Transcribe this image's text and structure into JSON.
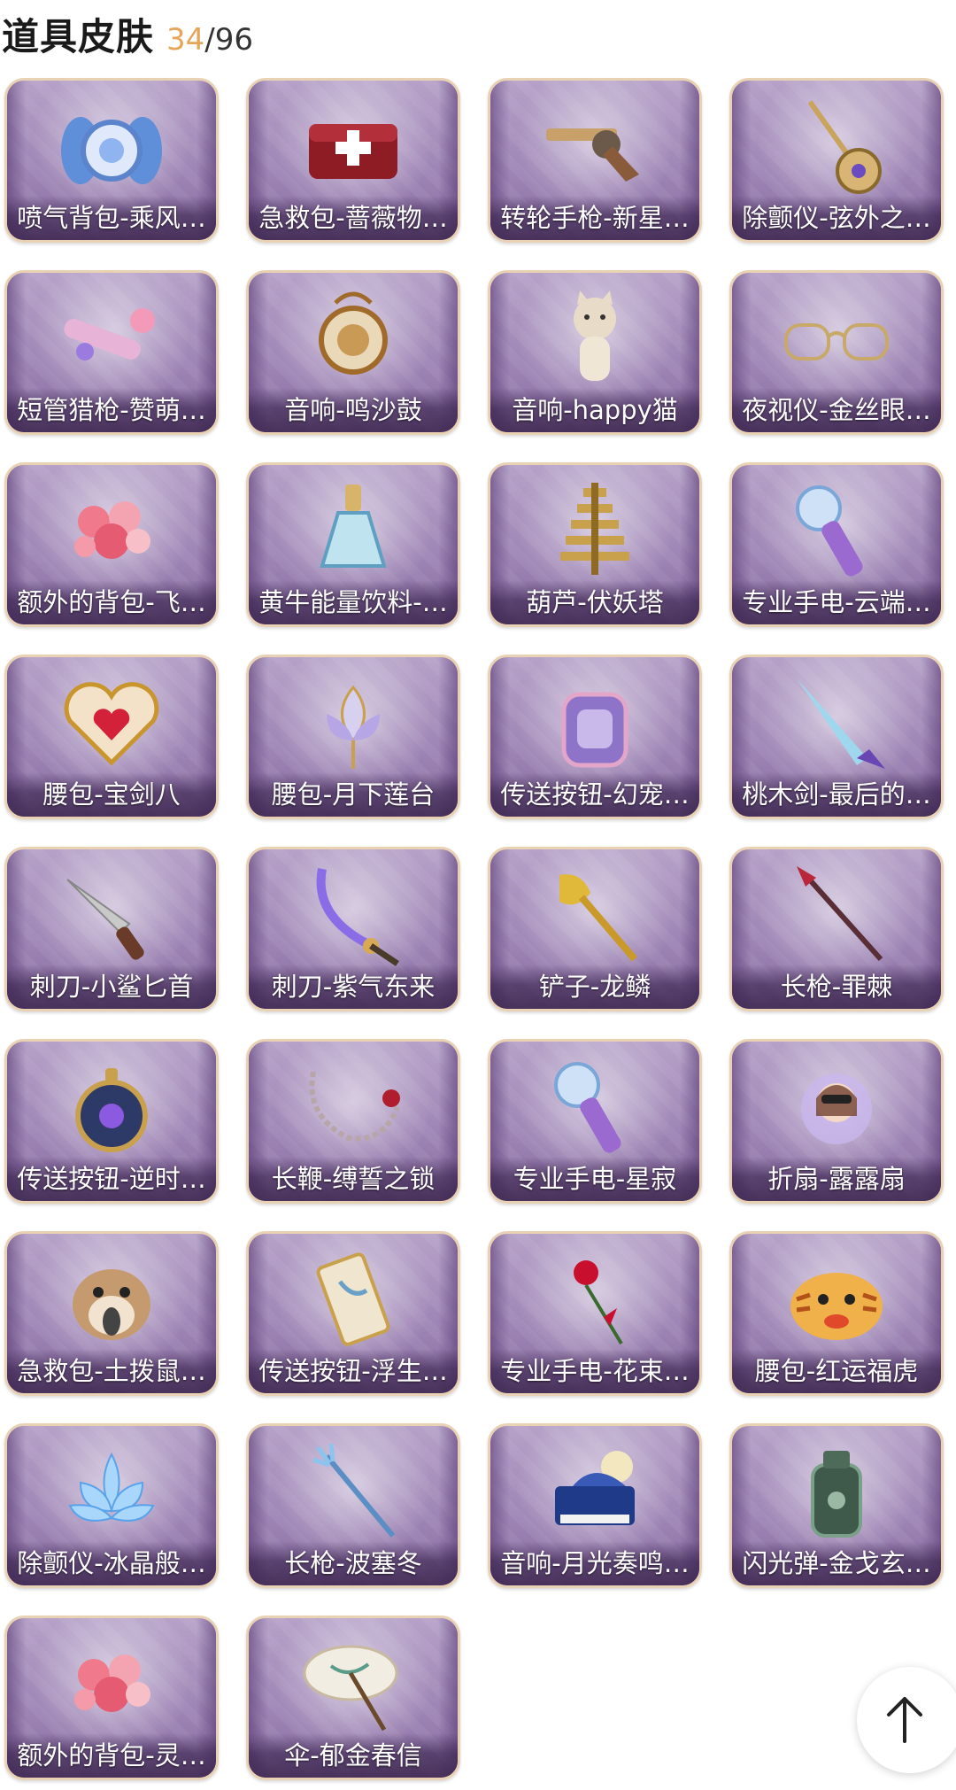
{
  "header": {
    "title": "道具皮肤",
    "owned": "34",
    "separator": "/",
    "total": "96"
  },
  "items": [
    {
      "label": "喷气背包-乘风…",
      "icon": "jetpack-icon"
    },
    {
      "label": "急救包-蔷薇物…",
      "icon": "first-aid-kit-icon"
    },
    {
      "label": "转轮手枪-新星…",
      "icon": "revolver-icon"
    },
    {
      "label": "除颤仪-弦外之…",
      "icon": "lute-icon"
    },
    {
      "label": "短管猎枪-赞萌…",
      "icon": "toy-shotgun-icon"
    },
    {
      "label": "音响-鸣沙鼓",
      "icon": "drum-icon"
    },
    {
      "label": "音响-happy猫",
      "icon": "cat-figure-icon"
    },
    {
      "label": "夜视仪-金丝眼…",
      "icon": "glasses-icon"
    },
    {
      "label": "额外的背包-飞…",
      "icon": "flower-bouquet-icon"
    },
    {
      "label": "黄牛能量饮料-…",
      "icon": "bottle-icon"
    },
    {
      "label": "葫芦-伏妖塔",
      "icon": "pagoda-icon"
    },
    {
      "label": "专业手电-云端…",
      "icon": "flashlight-icon"
    },
    {
      "label": "腰包-宝剑八",
      "icon": "heart-pouch-icon"
    },
    {
      "label": "腰包-月下莲台",
      "icon": "lotus-pouch-icon"
    },
    {
      "label": "传送按钮-幻宠…",
      "icon": "device-icon"
    },
    {
      "label": "桃木剑-最后的…",
      "icon": "horn-sword-icon"
    },
    {
      "label": "刺刀-小鲨匕首",
      "icon": "shark-dagger-icon"
    },
    {
      "label": "刺刀-紫气东来",
      "icon": "curved-blade-icon"
    },
    {
      "label": "铲子-龙鳞",
      "icon": "shovel-icon"
    },
    {
      "label": "长枪-罪棘",
      "icon": "spear-icon"
    },
    {
      "label": "传送按钮-逆时…",
      "icon": "pocket-watch-icon"
    },
    {
      "label": "长鞭-缚誓之锁",
      "icon": "chain-whip-icon"
    },
    {
      "label": "专业手电-星寂",
      "icon": "flashlight-icon"
    },
    {
      "label": "折扇-露露扇",
      "icon": "character-fan-icon"
    },
    {
      "label": "急救包-土拨鼠…",
      "icon": "hamster-icon"
    },
    {
      "label": "传送按钮-浮生…",
      "icon": "scroll-icon"
    },
    {
      "label": "专业手电-花束…",
      "icon": "rose-icon"
    },
    {
      "label": "腰包-红运福虎",
      "icon": "tiger-pouch-icon"
    },
    {
      "label": "除颤仪-冰晶般…",
      "icon": "ice-lotus-icon"
    },
    {
      "label": "长枪-波塞冬",
      "icon": "trident-icon"
    },
    {
      "label": "音响-月光奏鸣…",
      "icon": "piano-icon"
    },
    {
      "label": "闪光弹-金戈玄…",
      "icon": "bronze-grenade-icon"
    },
    {
      "label": "额外的背包-灵…",
      "icon": "flower-bouquet-icon"
    },
    {
      "label": "伞-郁金春信",
      "icon": "umbrella-icon"
    }
  ],
  "scroll_top": {
    "icon": "arrow-up-icon"
  }
}
